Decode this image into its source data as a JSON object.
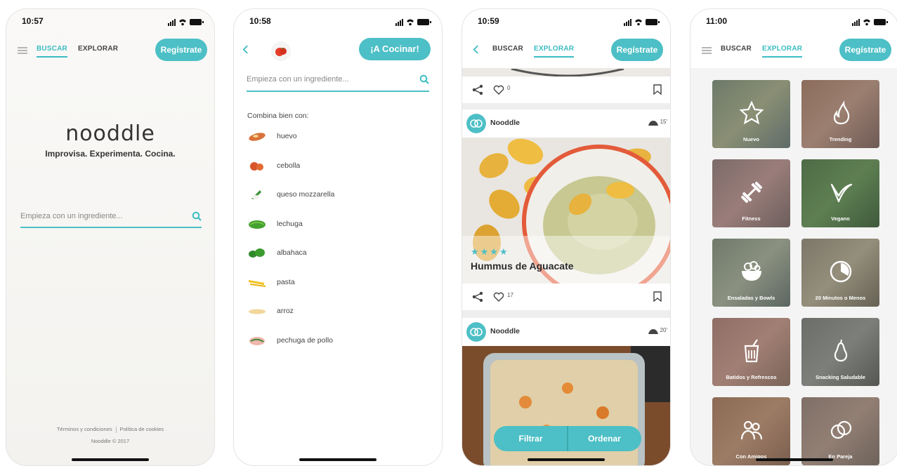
{
  "screens": [
    {
      "status_time": "10:57",
      "tabs": {
        "search": "BUSCAR",
        "explore": "EXPLORAR"
      },
      "register_label": "Regístrate",
      "logo_text": "nooddle",
      "tagline": "Improvisa. Experimenta. Cocina.",
      "search_placeholder": "Empieza con un ingrediente...",
      "footer": {
        "terms": "Términos y condiciones",
        "cookies": "Política de cookies",
        "copyright": "Nooddle © 2017"
      }
    },
    {
      "status_time": "10:58",
      "cook_label": "¡A Cocinar!",
      "search_placeholder": "Empieza con un ingrediente...",
      "pairs_title": "Combina bien con:",
      "ingredients": [
        "huevo",
        "cebolla",
        "queso mozzarella",
        "lechuga",
        "albahaca",
        "pasta",
        "arroz",
        "pechuga de pollo"
      ]
    },
    {
      "status_time": "10:59",
      "tabs": {
        "search": "BUSCAR",
        "explore": "EXPLORAR"
      },
      "register_label": "Regístrate",
      "cards": [
        {
          "likes": "0"
        },
        {
          "author": "Nooddle",
          "time": "15'",
          "title": "Hummus de Aguacate",
          "stars": "★★★★",
          "likes": "17"
        },
        {
          "author": "Nooddle",
          "time": "20'"
        }
      ],
      "filter_label": "Filtrar",
      "sort_label": "Ordenar"
    },
    {
      "status_time": "11:00",
      "tabs": {
        "search": "BUSCAR",
        "explore": "EXPLORAR"
      },
      "register_label": "Regístrate",
      "categories": [
        {
          "label": "Nuevo",
          "icon": "star-icon"
        },
        {
          "label": "Trending",
          "icon": "flame-icon"
        },
        {
          "label": "Fitness",
          "icon": "dumbbell-icon"
        },
        {
          "label": "Vegano",
          "icon": "leaf-icon"
        },
        {
          "label": "Ensaladas y Bowls",
          "icon": "salad-bowl-icon"
        },
        {
          "label": "20 Minutos o Menos",
          "icon": "clock-icon"
        },
        {
          "label": "Batidos y Refrescos",
          "icon": "smoothie-icon"
        },
        {
          "label": "Snacking Saludable",
          "icon": "pear-icon"
        },
        {
          "label": "Con Amigos",
          "icon": "friends-icon"
        },
        {
          "label": "En Pareja",
          "icon": "rings-icon"
        }
      ]
    }
  ],
  "colors": {
    "accent": "#4dbfc6",
    "text_dark": "#333333"
  }
}
